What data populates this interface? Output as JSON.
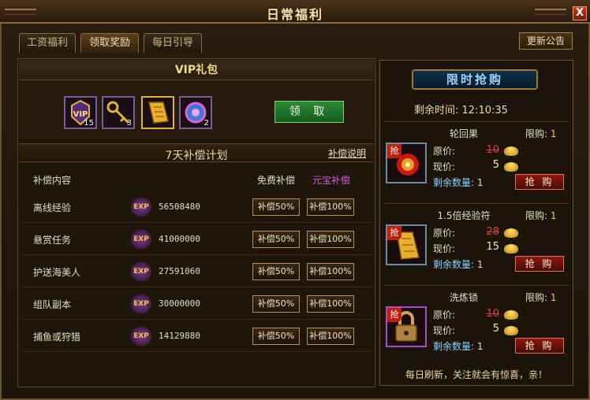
{
  "window": {
    "title": "日常福利",
    "close": "X"
  },
  "tabs": [
    {
      "label": "工资福利"
    },
    {
      "label": "领取奖励"
    },
    {
      "label": "每日引导"
    }
  ],
  "notice_button": "更新公告",
  "vip": {
    "header": "VIP礼包",
    "items": [
      {
        "icon": "vip-badge-icon",
        "count": "15"
      },
      {
        "icon": "golden-key-icon",
        "count": "3"
      },
      {
        "icon": "scroll-icon",
        "count": ""
      },
      {
        "icon": "gem-orb-icon",
        "count": "2"
      }
    ],
    "claim": "领 取"
  },
  "plan": {
    "title": "7天补偿计划",
    "link": "补偿说明",
    "col_content": "补偿内容",
    "col_free": "免费补偿",
    "col_ingot": "元宝补偿",
    "exp_label": "EXP",
    "rows": [
      {
        "name": "离线经验",
        "value": "56508480",
        "free": "补偿50%",
        "paid": "补偿100%"
      },
      {
        "name": "悬赏任务",
        "value": "41000000",
        "free": "补偿50%",
        "paid": "补偿100%"
      },
      {
        "name": "护送海美人",
        "value": "27591060",
        "free": "补偿50%",
        "paid": "补偿100%"
      },
      {
        "name": "组队副本",
        "value": "30000000",
        "free": "补偿50%",
        "paid": "补偿100%"
      },
      {
        "name": "捕鱼或狩猎",
        "value": "14129880",
        "free": "补偿50%",
        "paid": "补偿100%"
      }
    ]
  },
  "sale": {
    "banner": "限时抢购",
    "remain_label": "剩余时间:",
    "remain_time": "12:10:35",
    "tag": "抢",
    "orig_label": "原价:",
    "now_label": "现价:",
    "rest_label": "剩余数量:",
    "limit_label": "限购:",
    "buy": "抢 购",
    "items": [
      {
        "name": "轮回果",
        "limit": "1",
        "orig": "10",
        "now": "5",
        "rest": "1"
      },
      {
        "name": "1.5倍经验符",
        "limit": "1",
        "orig": "28",
        "now": "15",
        "rest": "1"
      },
      {
        "name": "洗炼锁",
        "limit": "1",
        "orig": "10",
        "now": "5",
        "rest": "1"
      }
    ],
    "footer": "每日刷新，关注就会有惊喜，亲！"
  }
}
